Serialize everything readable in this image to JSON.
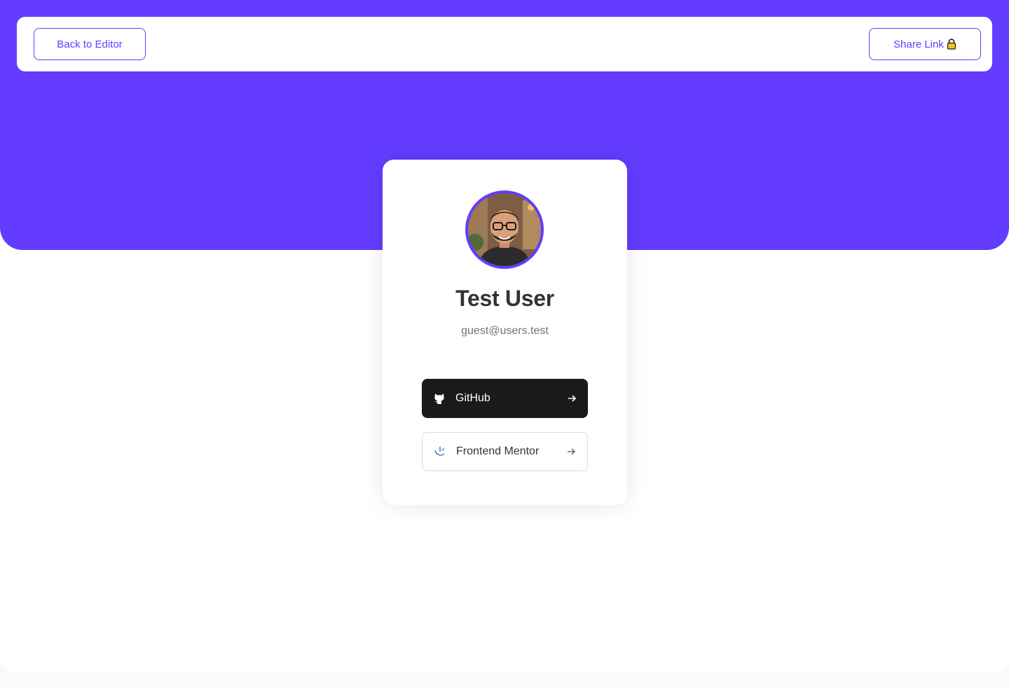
{
  "topbar": {
    "back_label": "Back to Editor",
    "share_label": "Share Link",
    "share_icon": "lock-icon"
  },
  "profile": {
    "name": "Test User",
    "email": "guest@users.test",
    "avatar": "avatar-photo"
  },
  "links": [
    {
      "platform": "GitHub",
      "icon": "github-icon",
      "color": "#1a1a1a"
    },
    {
      "platform": "Frontend Mentor",
      "icon": "frontend-mentor-icon",
      "color": "#ffffff"
    }
  ],
  "colors": {
    "accent": "#633cff",
    "dark": "#333333",
    "muted": "#737373"
  }
}
